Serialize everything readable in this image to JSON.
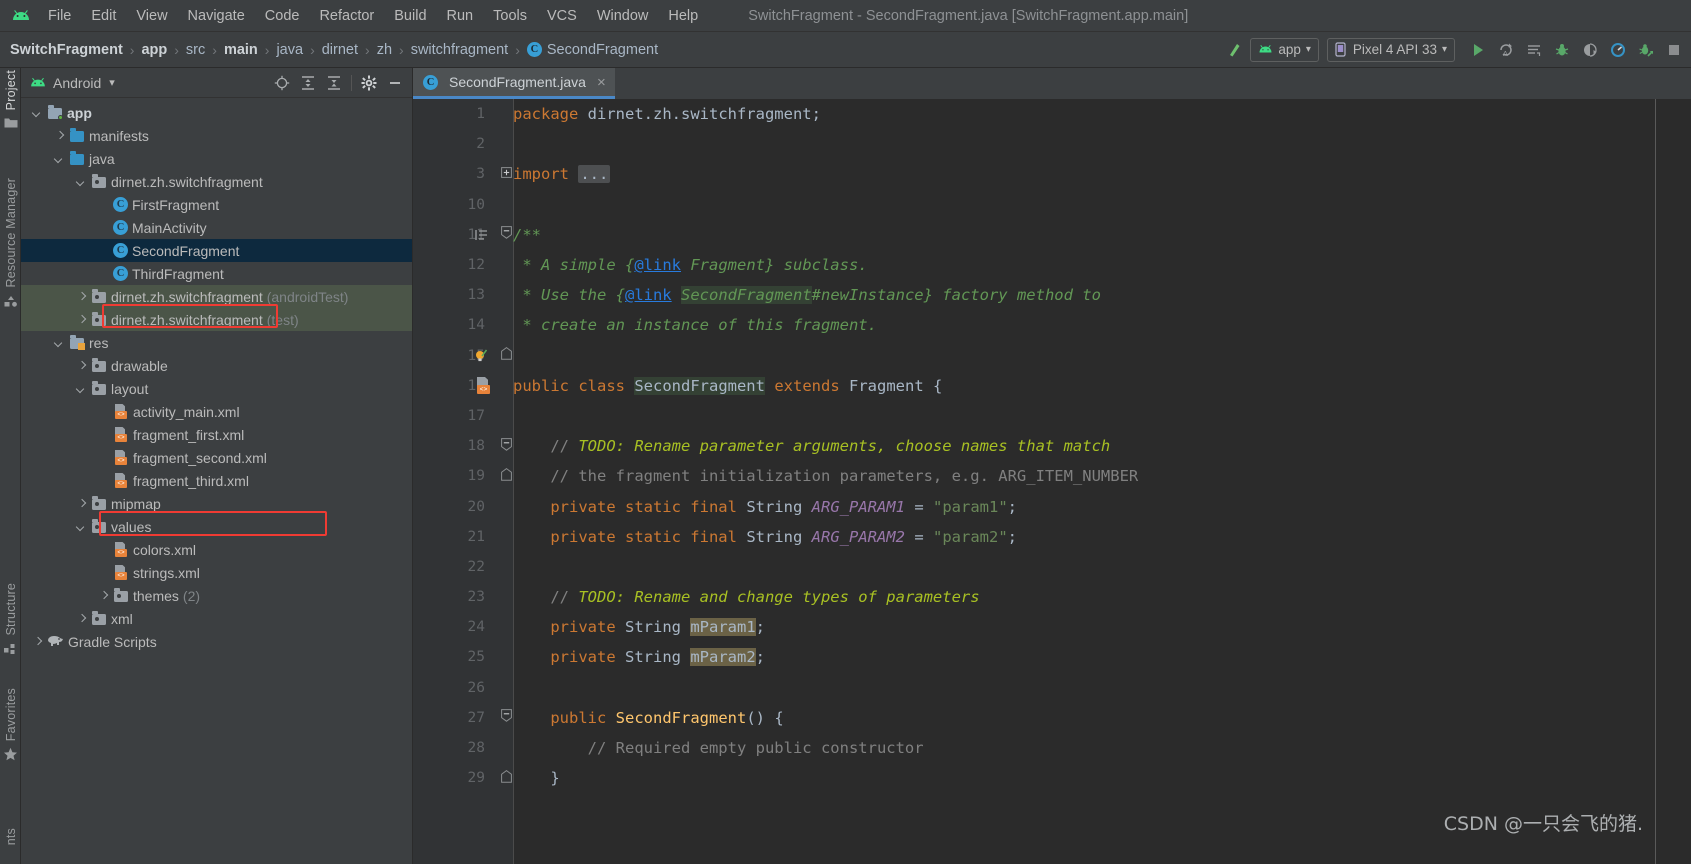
{
  "window": {
    "title": "SwitchFragment - SecondFragment.java [SwitchFragment.app.main]",
    "logo_icon": "android-logo-icon"
  },
  "menubar": {
    "items": [
      {
        "label": "File"
      },
      {
        "label": "Edit"
      },
      {
        "label": "View"
      },
      {
        "label": "Navigate"
      },
      {
        "label": "Code"
      },
      {
        "label": "Refactor"
      },
      {
        "label": "Build"
      },
      {
        "label": "Run"
      },
      {
        "label": "Tools"
      },
      {
        "label": "VCS"
      },
      {
        "label": "Window"
      },
      {
        "label": "Help"
      }
    ]
  },
  "breadcrumb": {
    "items": [
      {
        "label": "SwitchFragment",
        "bold": true
      },
      {
        "label": "app",
        "bold": true
      },
      {
        "label": "src",
        "bold": false
      },
      {
        "label": "main",
        "bold": true
      },
      {
        "label": "java",
        "bold": false
      },
      {
        "label": "dirnet",
        "bold": false
      },
      {
        "label": "zh",
        "bold": false
      },
      {
        "label": "switchfragment",
        "bold": false
      }
    ],
    "last": "SecondFragment",
    "last_icon_letter": "C",
    "separator": "›"
  },
  "toolbar": {
    "build_variant_icon": "hammer-icon",
    "run_config": {
      "label": "app",
      "icon": "android-app-icon",
      "caret": "▾"
    },
    "device": {
      "label": "Pixel 4 API 33",
      "icon": "device-phone-icon",
      "caret": "▾"
    },
    "actions": [
      {
        "name": "run-button",
        "icon": "play-icon"
      },
      {
        "name": "apply-changes-button",
        "icon": "apply-changes-icon"
      },
      {
        "name": "logcat-button",
        "icon": "logcat-icon"
      },
      {
        "name": "debug-button",
        "icon": "debug-bug-icon"
      },
      {
        "name": "run-coverage-button",
        "icon": "coverage-icon"
      },
      {
        "name": "profiler-button",
        "icon": "profiler-gauge-icon"
      },
      {
        "name": "attach-debugger-button",
        "icon": "attach-debugger-icon"
      },
      {
        "name": "stop-button",
        "icon": "stop-square-icon"
      }
    ]
  },
  "left_rail": {
    "buttons": [
      {
        "label": "Project",
        "icon": "project-folder-icon",
        "active": true
      },
      {
        "label": "Resource Manager",
        "icon": "resource-manager-icon",
        "active": false
      },
      {
        "label": "Structure",
        "icon": "structure-icon",
        "active": false
      },
      {
        "label": "Favorites",
        "icon": "favorites-star-icon",
        "active": false
      },
      {
        "label": "nts",
        "icon": "build-variants-icon",
        "active": false
      }
    ]
  },
  "project_panel": {
    "title": "Android",
    "title_icon": "android-head-icon",
    "caret": "▾",
    "header_actions": [
      {
        "name": "select-opened-file-button",
        "icon": "target-crosshair-icon"
      },
      {
        "name": "expand-all-button",
        "icon": "expand-all-icon"
      },
      {
        "name": "collapse-all-button",
        "icon": "collapse-all-icon"
      },
      {
        "name": "panel-settings-button",
        "icon": "gear-icon"
      },
      {
        "name": "hide-panel-button",
        "icon": "minimize-icon"
      }
    ],
    "tree": [
      {
        "label": "app",
        "suffix": "",
        "indent": 0,
        "arrow": "down",
        "icon": "module-folder-icon",
        "bold": true,
        "selected": false,
        "testsrc": false
      },
      {
        "label": "manifests",
        "suffix": "",
        "indent": 1,
        "arrow": "right",
        "icon": "folder-icon",
        "bold": false,
        "selected": false,
        "testsrc": false
      },
      {
        "label": "java",
        "suffix": "",
        "indent": 1,
        "arrow": "down",
        "icon": "folder-icon",
        "bold": false,
        "selected": false,
        "testsrc": false
      },
      {
        "label": "dirnet.zh.switchfragment",
        "suffix": "",
        "indent": 2,
        "arrow": "down",
        "icon": "package-icon",
        "bold": false,
        "selected": false,
        "testsrc": false
      },
      {
        "label": "FirstFragment",
        "suffix": "",
        "indent": 3,
        "arrow": "none",
        "icon": "class-icon",
        "bold": false,
        "selected": false,
        "testsrc": false
      },
      {
        "label": "MainActivity",
        "suffix": "",
        "indent": 3,
        "arrow": "none",
        "icon": "class-icon",
        "bold": false,
        "selected": false,
        "testsrc": false
      },
      {
        "label": "SecondFragment",
        "suffix": "",
        "indent": 3,
        "arrow": "none",
        "icon": "class-icon",
        "bold": false,
        "selected": true,
        "testsrc": false
      },
      {
        "label": "ThirdFragment",
        "suffix": "",
        "indent": 3,
        "arrow": "none",
        "icon": "class-icon",
        "bold": false,
        "selected": false,
        "testsrc": false
      },
      {
        "label": "dirnet.zh.switchfragment",
        "suffix": "(androidTest)",
        "indent": 2,
        "arrow": "right",
        "icon": "package-icon",
        "bold": false,
        "selected": false,
        "testsrc": true
      },
      {
        "label": "dirnet.zh.switchfragment",
        "suffix": "(test)",
        "indent": 2,
        "arrow": "right",
        "icon": "package-icon",
        "bold": false,
        "selected": false,
        "testsrc": true
      },
      {
        "label": "res",
        "suffix": "",
        "indent": 1,
        "arrow": "down",
        "icon": "res-folder-icon",
        "bold": false,
        "selected": false,
        "testsrc": false
      },
      {
        "label": "drawable",
        "suffix": "",
        "indent": 2,
        "arrow": "right",
        "icon": "package-icon",
        "bold": false,
        "selected": false,
        "testsrc": false
      },
      {
        "label": "layout",
        "suffix": "",
        "indent": 2,
        "arrow": "down",
        "icon": "package-icon",
        "bold": false,
        "selected": false,
        "testsrc": false
      },
      {
        "label": "activity_main.xml",
        "suffix": "",
        "indent": 3,
        "arrow": "none",
        "icon": "xml-file-icon",
        "bold": false,
        "selected": false,
        "testsrc": false
      },
      {
        "label": "fragment_first.xml",
        "suffix": "",
        "indent": 3,
        "arrow": "none",
        "icon": "xml-file-icon",
        "bold": false,
        "selected": false,
        "testsrc": false
      },
      {
        "label": "fragment_second.xml",
        "suffix": "",
        "indent": 3,
        "arrow": "none",
        "icon": "xml-file-icon",
        "bold": false,
        "selected": false,
        "testsrc": false
      },
      {
        "label": "fragment_third.xml",
        "suffix": "",
        "indent": 3,
        "arrow": "none",
        "icon": "xml-file-icon",
        "bold": false,
        "selected": false,
        "testsrc": false
      },
      {
        "label": "mipmap",
        "suffix": "",
        "indent": 2,
        "arrow": "right",
        "icon": "package-icon",
        "bold": false,
        "selected": false,
        "testsrc": false
      },
      {
        "label": "values",
        "suffix": "",
        "indent": 2,
        "arrow": "down",
        "icon": "package-icon",
        "bold": false,
        "selected": false,
        "testsrc": false
      },
      {
        "label": "colors.xml",
        "suffix": "",
        "indent": 3,
        "arrow": "none",
        "icon": "xml-file-icon",
        "bold": false,
        "selected": false,
        "testsrc": false
      },
      {
        "label": "strings.xml",
        "suffix": "",
        "indent": 3,
        "arrow": "none",
        "icon": "xml-file-icon",
        "bold": false,
        "selected": false,
        "testsrc": false
      },
      {
        "label": "themes",
        "suffix": "(2)",
        "indent": 3,
        "arrow": "right",
        "icon": "package-icon",
        "bold": false,
        "selected": false,
        "testsrc": false
      },
      {
        "label": "xml",
        "suffix": "",
        "indent": 2,
        "arrow": "right",
        "icon": "package-icon",
        "bold": false,
        "selected": false,
        "testsrc": false
      },
      {
        "label": "Gradle Scripts",
        "suffix": "",
        "indent": 0,
        "arrow": "right",
        "icon": "gradle-elephant-icon",
        "bold": false,
        "selected": false,
        "testsrc": false
      }
    ],
    "highlight_rows": [
      6,
      15
    ]
  },
  "editor": {
    "tab": {
      "label": "SecondFragment.java",
      "icon_letter": "C",
      "close": "×"
    },
    "lines": [
      {
        "num": "1",
        "gutter": "",
        "fold": "",
        "html": "<span class='kw'>package</span> <span class='pl'>dirnet.zh.switchfragment;</span>"
      },
      {
        "num": "2",
        "gutter": "",
        "fold": "",
        "html": ""
      },
      {
        "num": "3",
        "gutter": "",
        "fold": "plus",
        "html": "<span class='kw'>import</span> <span class='fold-ph'>...</span>"
      },
      {
        "num": "10",
        "gutter": "",
        "fold": "",
        "html": ""
      },
      {
        "num": "11",
        "gutter": "doc-align",
        "fold": "minus",
        "html": "<span class='doc'>/**</span>"
      },
      {
        "num": "12",
        "gutter": "",
        "fold": "",
        "html": "<span class='doc'> * A simple {</span><span class='doctag'>@link</span><span class='doc'> Fragment} subclass.</span>"
      },
      {
        "num": "13",
        "gutter": "",
        "fold": "",
        "html": "<span class='doc'> * Use the {</span><span class='doctag'>@link</span><span class='doc'> </span><span class='doc ident-hl'>SecondFragment</span><span class='doc'>#newInstance} factory method to</span>"
      },
      {
        "num": "14",
        "gutter": "",
        "fold": "",
        "html": "<span class='doc'> * create an instance of this fragment.</span>"
      },
      {
        "num": "15",
        "gutter": "bulb",
        "fold": "end",
        "html": "<span class='doc'> </span>"
      },
      {
        "num": "16",
        "gutter": "xml",
        "fold": "",
        "html": "<span class='kw'>public class</span> <span class='pl ident-hl'>SecondFragment</span> <span class='kw'>extends</span> <span class='pl'>Fragment {</span>"
      },
      {
        "num": "17",
        "gutter": "",
        "fold": "",
        "html": ""
      },
      {
        "num": "18",
        "gutter": "",
        "fold": "minus",
        "html": "    <span class='cmt'>// </span><span class='todo'>TODO: Rename parameter arguments, choose names that match</span>"
      },
      {
        "num": "19",
        "gutter": "",
        "fold": "end",
        "html": "    <span class='cmt'>// the fragment initialization parameters, e.g. ARG_ITEM_NUMBER</span>"
      },
      {
        "num": "20",
        "gutter": "",
        "fold": "",
        "html": "    <span class='kw'>private static final</span> <span class='pl'>String</span> <span class='field'>ARG_PARAM1</span> <span class='pl'>=</span> <span class='str'>\"param1\"</span><span class='pl'>;</span>"
      },
      {
        "num": "21",
        "gutter": "",
        "fold": "",
        "html": "    <span class='kw'>private static final</span> <span class='pl'>String</span> <span class='field'>ARG_PARAM2</span> <span class='pl'>=</span> <span class='str'>\"param2\"</span><span class='pl'>;</span>"
      },
      {
        "num": "22",
        "gutter": "",
        "fold": "",
        "html": ""
      },
      {
        "num": "23",
        "gutter": "",
        "fold": "",
        "html": "    <span class='cmt'>// </span><span class='todo'>TODO: Rename and change types of parameters</span>"
      },
      {
        "num": "24",
        "gutter": "",
        "fold": "",
        "html": "    <span class='kw'>private</span> <span class='pl'>String</span> <span class='pl ident-hl2'>mParam1</span><span class='pl'>;</span>"
      },
      {
        "num": "25",
        "gutter": "",
        "fold": "",
        "html": "    <span class='kw'>private</span> <span class='pl'>String</span> <span class='pl ident-hl2'>mParam2</span><span class='pl'>;</span>"
      },
      {
        "num": "26",
        "gutter": "",
        "fold": "",
        "html": ""
      },
      {
        "num": "27",
        "gutter": "",
        "fold": "minus",
        "html": "    <span class='kw'>public</span> <span class='cname'>SecondFragment</span><span class='pl'>() {</span>"
      },
      {
        "num": "28",
        "gutter": "",
        "fold": "",
        "html": "        <span class='cmt'>// Required empty public constructor</span>"
      },
      {
        "num": "29",
        "gutter": "",
        "fold": "end",
        "html": "    <span class='pl'>}</span>"
      }
    ]
  },
  "watermark": {
    "text": "CSDN @一只会飞的猪."
  },
  "colors": {
    "chrome": "#3c3f41",
    "editor_bg": "#2b2b2b",
    "gutter_bg": "#313335",
    "selection": "#0d293e",
    "test_source": "#4b5548",
    "accent_blue": "#4a88c7",
    "annotation_red": "#f03b33",
    "android_green": "#3ddc84"
  }
}
